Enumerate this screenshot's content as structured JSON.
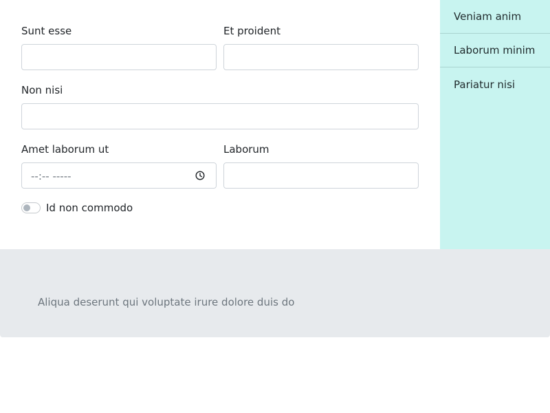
{
  "form": {
    "field1": {
      "label": "Sunt esse",
      "value": "",
      "placeholder": ""
    },
    "field2": {
      "label": "Et proident",
      "value": "",
      "placeholder": ""
    },
    "field3": {
      "label": "Non nisi",
      "value": "",
      "placeholder": ""
    },
    "field4": {
      "label": "Amet laborum ut",
      "display": "--:-- -----",
      "icon": "clock-icon"
    },
    "field5": {
      "label": "Laborum",
      "value": "",
      "placeholder": ""
    },
    "toggle": {
      "label": "Id non commodo",
      "checked": false
    }
  },
  "sidebar": {
    "items": [
      {
        "label": "Veniam anim"
      },
      {
        "label": "Laborum minim"
      },
      {
        "label": "Pariatur nisi"
      }
    ]
  },
  "footer": {
    "text": "Aliqua deserunt qui voluptate irure dolore duis do"
  },
  "colors": {
    "sidebar_bg": "#c8f4f0",
    "footer_bg": "#e7eaed",
    "input_border": "#ced4da"
  }
}
